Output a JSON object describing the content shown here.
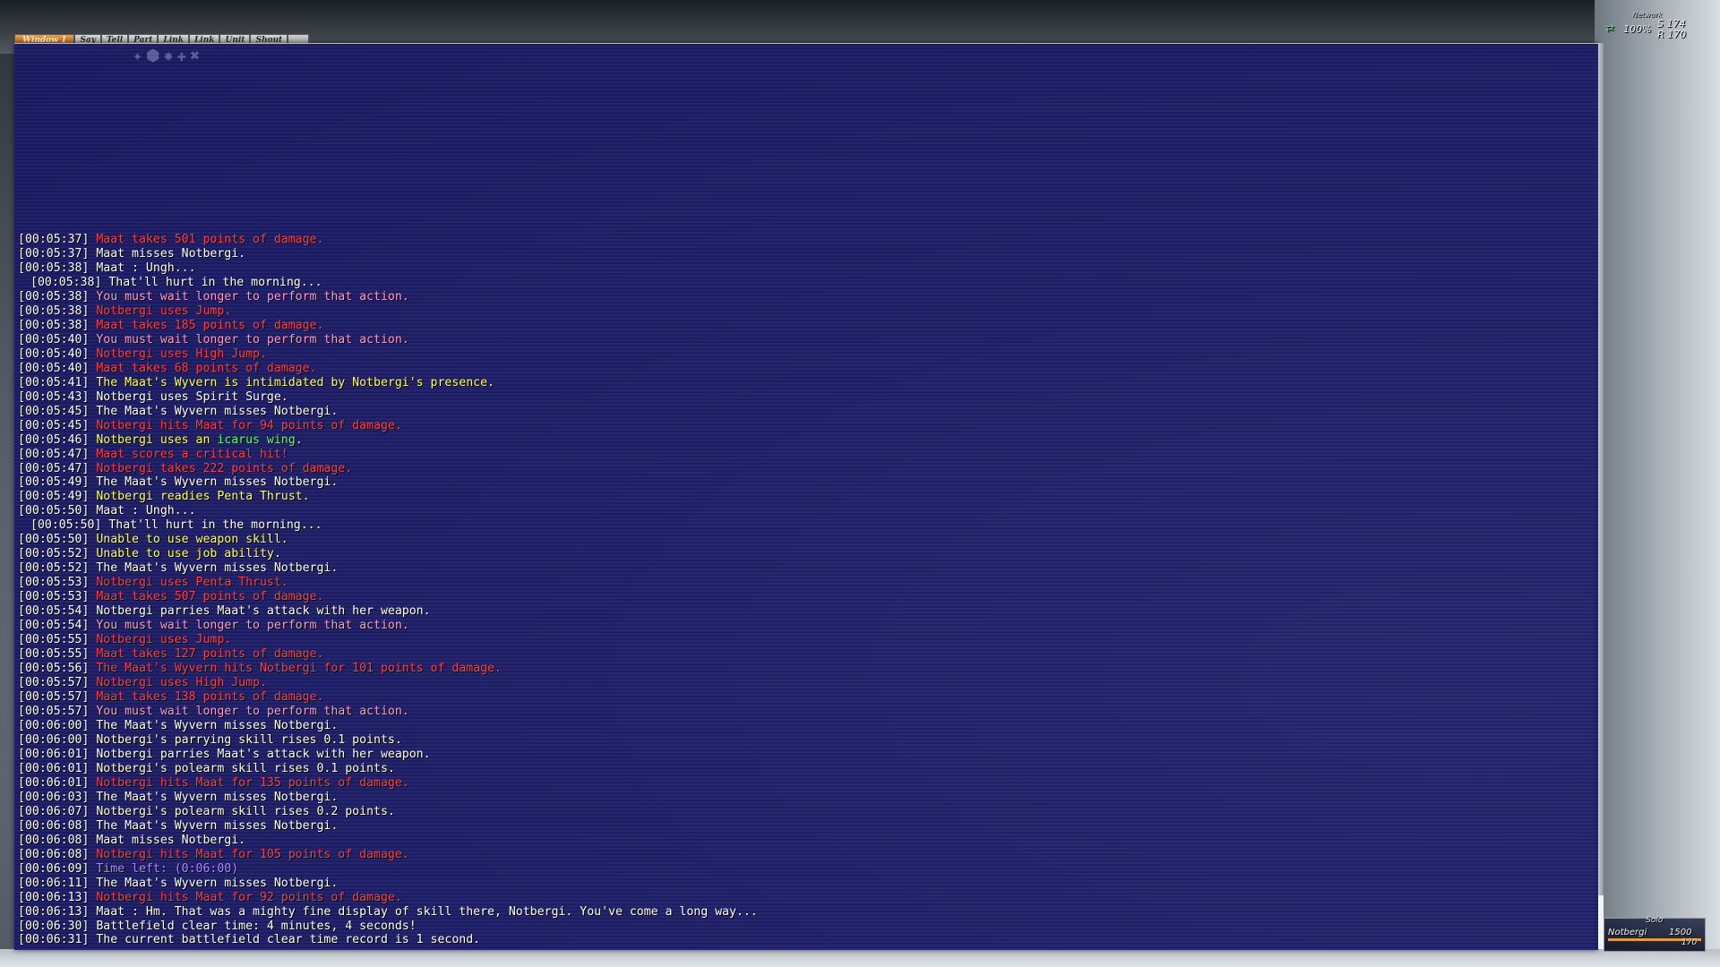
{
  "tabs": [
    "Window 1",
    "Say",
    "Tell",
    "Part",
    "Link",
    "Link",
    "Unit",
    "Shout"
  ],
  "network": {
    "label": "Network",
    "percent": "100%",
    "s_value": "S 174",
    "r_value": "R 170"
  },
  "party": {
    "mode": "Solo",
    "name": "Notbergi",
    "hp": "1500",
    "mp": "170"
  },
  "chat_lines": [
    {
      "ts": "[00:05:37]",
      "text": "Maat takes 501 points of damage.",
      "color": "red"
    },
    {
      "ts": "[00:05:37]",
      "text": "Maat misses Notbergi.",
      "color": "white"
    },
    {
      "ts": "[00:05:38]",
      "text": "Maat : Ungh...",
      "color": "white"
    },
    {
      "ts": "[00:05:38]",
      "text": "That'll hurt in the morning...",
      "color": "white",
      "indent": true
    },
    {
      "ts": "[00:05:38]",
      "text": "You must wait longer to perform that action.",
      "color": "pink"
    },
    {
      "ts": "[00:05:38]",
      "text": "Notbergi uses Jump.",
      "color": "red"
    },
    {
      "ts": "[00:05:38]",
      "text": "Maat takes 185 points of damage.",
      "color": "red"
    },
    {
      "ts": "[00:05:40]",
      "text": "You must wait longer to perform that action.",
      "color": "pink"
    },
    {
      "ts": "[00:05:40]",
      "text": "Notbergi uses High Jump.",
      "color": "red"
    },
    {
      "ts": "[00:05:40]",
      "text": "Maat takes 68 points of damage.",
      "color": "red"
    },
    {
      "ts": "[00:05:41]",
      "text": "The Maat's Wyvern is intimidated by Notbergi's presence.",
      "color": "yellow"
    },
    {
      "ts": "[00:05:43]",
      "text": "Notbergi uses Spirit Surge.",
      "color": "white"
    },
    {
      "ts": "[00:05:45]",
      "text": "The Maat's Wyvern misses Notbergi.",
      "color": "white"
    },
    {
      "ts": "[00:05:45]",
      "text": "Notbergi hits Maat for 94 points of damage.",
      "color": "red"
    },
    {
      "ts": "[00:05:46]",
      "text": "Notbergi uses an ",
      "color": "yellow",
      "extra": "icarus wing",
      "extra_color": "green",
      "tail": "."
    },
    {
      "ts": "[00:05:47]",
      "text": "Maat scores a critical hit!",
      "color": "red"
    },
    {
      "ts": "[00:05:47]",
      "text": "Notbergi takes 222 points of damage.",
      "color": "red"
    },
    {
      "ts": "[00:05:49]",
      "text": "The Maat's Wyvern misses Notbergi.",
      "color": "white"
    },
    {
      "ts": "[00:05:49]",
      "text": "Notbergi readies Penta Thrust.",
      "color": "yellow"
    },
    {
      "ts": "[00:05:50]",
      "text": "Maat : Ungh...",
      "color": "white"
    },
    {
      "ts": "[00:05:50]",
      "text": "That'll hurt in the morning...",
      "color": "white",
      "indent": true
    },
    {
      "ts": "[00:05:50]",
      "text": "Unable to use weapon skill.",
      "color": "yellow"
    },
    {
      "ts": "[00:05:52]",
      "text": "Unable to use job ability.",
      "color": "yellow"
    },
    {
      "ts": "[00:05:52]",
      "text": "The Maat's Wyvern misses Notbergi.",
      "color": "white"
    },
    {
      "ts": "[00:05:53]",
      "text": "Notbergi uses Penta Thrust.",
      "color": "red"
    },
    {
      "ts": "[00:05:53]",
      "text": "Maat takes 507 points of damage.",
      "color": "red"
    },
    {
      "ts": "[00:05:54]",
      "text": "Notbergi parries Maat's attack with her weapon.",
      "color": "white"
    },
    {
      "ts": "[00:05:54]",
      "text": "You must wait longer to perform that action.",
      "color": "pink"
    },
    {
      "ts": "[00:05:55]",
      "text": "Notbergi uses Jump.",
      "color": "red"
    },
    {
      "ts": "[00:05:55]",
      "text": "Maat takes 127 points of damage.",
      "color": "red"
    },
    {
      "ts": "[00:05:56]",
      "text": "The Maat's Wyvern hits Notbergi for 101 points of damage.",
      "color": "red"
    },
    {
      "ts": "[00:05:57]",
      "text": "Notbergi uses High Jump.",
      "color": "red"
    },
    {
      "ts": "[00:05:57]",
      "text": "Maat takes 138 points of damage.",
      "color": "red"
    },
    {
      "ts": "[00:05:57]",
      "text": "You must wait longer to perform that action.",
      "color": "pink"
    },
    {
      "ts": "[00:06:00]",
      "text": "The Maat's Wyvern misses Notbergi.",
      "color": "white"
    },
    {
      "ts": "[00:06:00]",
      "text": "Notbergi's parrying skill rises 0.1 points.",
      "color": "paleyellow"
    },
    {
      "ts": "[00:06:01]",
      "text": "Notbergi parries Maat's attack with her weapon.",
      "color": "white"
    },
    {
      "ts": "[00:06:01]",
      "text": "Notbergi's polearm skill rises 0.1 points.",
      "color": "paleyellow"
    },
    {
      "ts": "[00:06:01]",
      "text": "Notbergi hits Maat for 135 points of damage.",
      "color": "red"
    },
    {
      "ts": "[00:06:03]",
      "text": "The Maat's Wyvern misses Notbergi.",
      "color": "white"
    },
    {
      "ts": "[00:06:07]",
      "text": "Notbergi's polearm skill rises 0.2 points.",
      "color": "paleyellow"
    },
    {
      "ts": "[00:06:08]",
      "text": "The Maat's Wyvern misses Notbergi.",
      "color": "white"
    },
    {
      "ts": "[00:06:08]",
      "text": "Maat misses Notbergi.",
      "color": "white"
    },
    {
      "ts": "[00:06:08]",
      "text": "Notbergi hits Maat for 105 points of damage.",
      "color": "red"
    },
    {
      "ts": "[00:06:09]",
      "text": "Time left: (0:06:00)",
      "color": "purple"
    },
    {
      "ts": "[00:06:11]",
      "text": "The Maat's Wyvern misses Notbergi.",
      "color": "white"
    },
    {
      "ts": "[00:06:13]",
      "text": "Notbergi hits Maat for 92 points of damage.",
      "color": "red"
    },
    {
      "ts": "[00:06:13]",
      "text": "Maat : Hm. That was a mighty fine display of skill there, Notbergi. You've come a long way...",
      "color": "white"
    },
    {
      "ts": "[00:06:30]",
      "text": "Battlefield clear time: 4 minutes, 4 seconds!",
      "color": "white"
    },
    {
      "ts": "[00:06:31]",
      "text": "The current battlefield clear time record is 1 second.",
      "color": "white"
    }
  ]
}
